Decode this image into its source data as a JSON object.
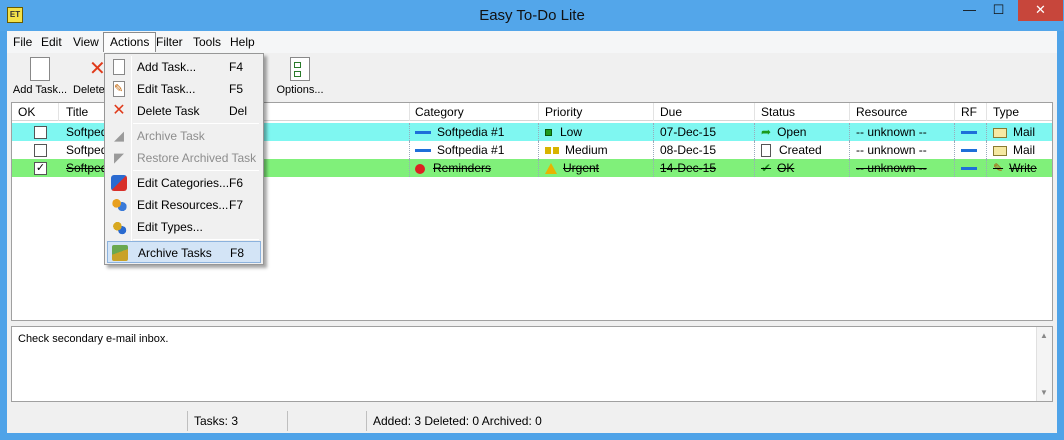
{
  "window": {
    "title": "Easy To-Do Lite",
    "icon_label": "ET",
    "minimize": "—",
    "maximize": "☐",
    "close": "✕"
  },
  "menubar": {
    "items": [
      {
        "label": "File"
      },
      {
        "label": "Edit"
      },
      {
        "label": "View"
      },
      {
        "label": "Actions"
      },
      {
        "label": "Filter"
      },
      {
        "label": "Tools"
      },
      {
        "label": "Help"
      }
    ]
  },
  "toolbar": {
    "add_task": "Add Task...",
    "delete": "Delete",
    "options": "Options..."
  },
  "grid": {
    "columns": [
      "OK",
      "Title",
      "Category",
      "Priority",
      "Due",
      "Status",
      "Resource",
      "RF",
      "Type"
    ],
    "rows": [
      {
        "checked": false,
        "title": "Softpedia",
        "category": "Softpedia #1",
        "priority": "Low",
        "due": "07-Dec-15",
        "status": "Open",
        "resource": "-- unknown --",
        "type": "Mail"
      },
      {
        "checked": false,
        "title": "Softpedi",
        "category": "Softpedia #1",
        "priority": "Medium",
        "due": "08-Dec-15",
        "status": "Created",
        "resource": "-- unknown --",
        "type": "Mail"
      },
      {
        "checked": true,
        "title": "Softpedia",
        "check_mark": "✓",
        "category": "Reminders",
        "priority": "Urgent",
        "due": "14-Dec-15",
        "status": "OK",
        "resource": "-- unknown --",
        "type": "Write"
      }
    ]
  },
  "notes": {
    "text": "Check secondary e-mail inbox."
  },
  "statusbar": {
    "tasks": "Tasks: 3",
    "summary": "Added: 3 Deleted: 0 Archived: 0"
  },
  "actions_menu": {
    "items": [
      {
        "label": "Add Task...",
        "shortcut": "F4",
        "icon": "add-task-icon"
      },
      {
        "label": "Edit Task...",
        "shortcut": "F5",
        "icon": "edit-task-icon"
      },
      {
        "label": "Delete Task",
        "shortcut": "Del",
        "icon": "delete-task-icon"
      },
      {
        "label": "Archive Task",
        "shortcut": "",
        "icon": "archive-task-icon",
        "disabled": true
      },
      {
        "label": "Restore Archived Task",
        "shortcut": "",
        "icon": "restore-task-icon",
        "disabled": true
      },
      {
        "label": "Edit Categories...",
        "shortcut": "F6",
        "icon": "categories-icon"
      },
      {
        "label": "Edit Resources...",
        "shortcut": "F7",
        "icon": "resources-icon"
      },
      {
        "label": "Edit Types...",
        "shortcut": "",
        "icon": "types-icon"
      },
      {
        "label": "Archive Tasks",
        "shortcut": "F8",
        "icon": "archive-tasks-icon"
      }
    ]
  },
  "colors": {
    "titlebar": "#53a6ea",
    "row_open": "#7ff7f1",
    "row_done": "#80f07a",
    "menu_highlight": "#d3e4f6",
    "close_button": "#c7463b"
  }
}
